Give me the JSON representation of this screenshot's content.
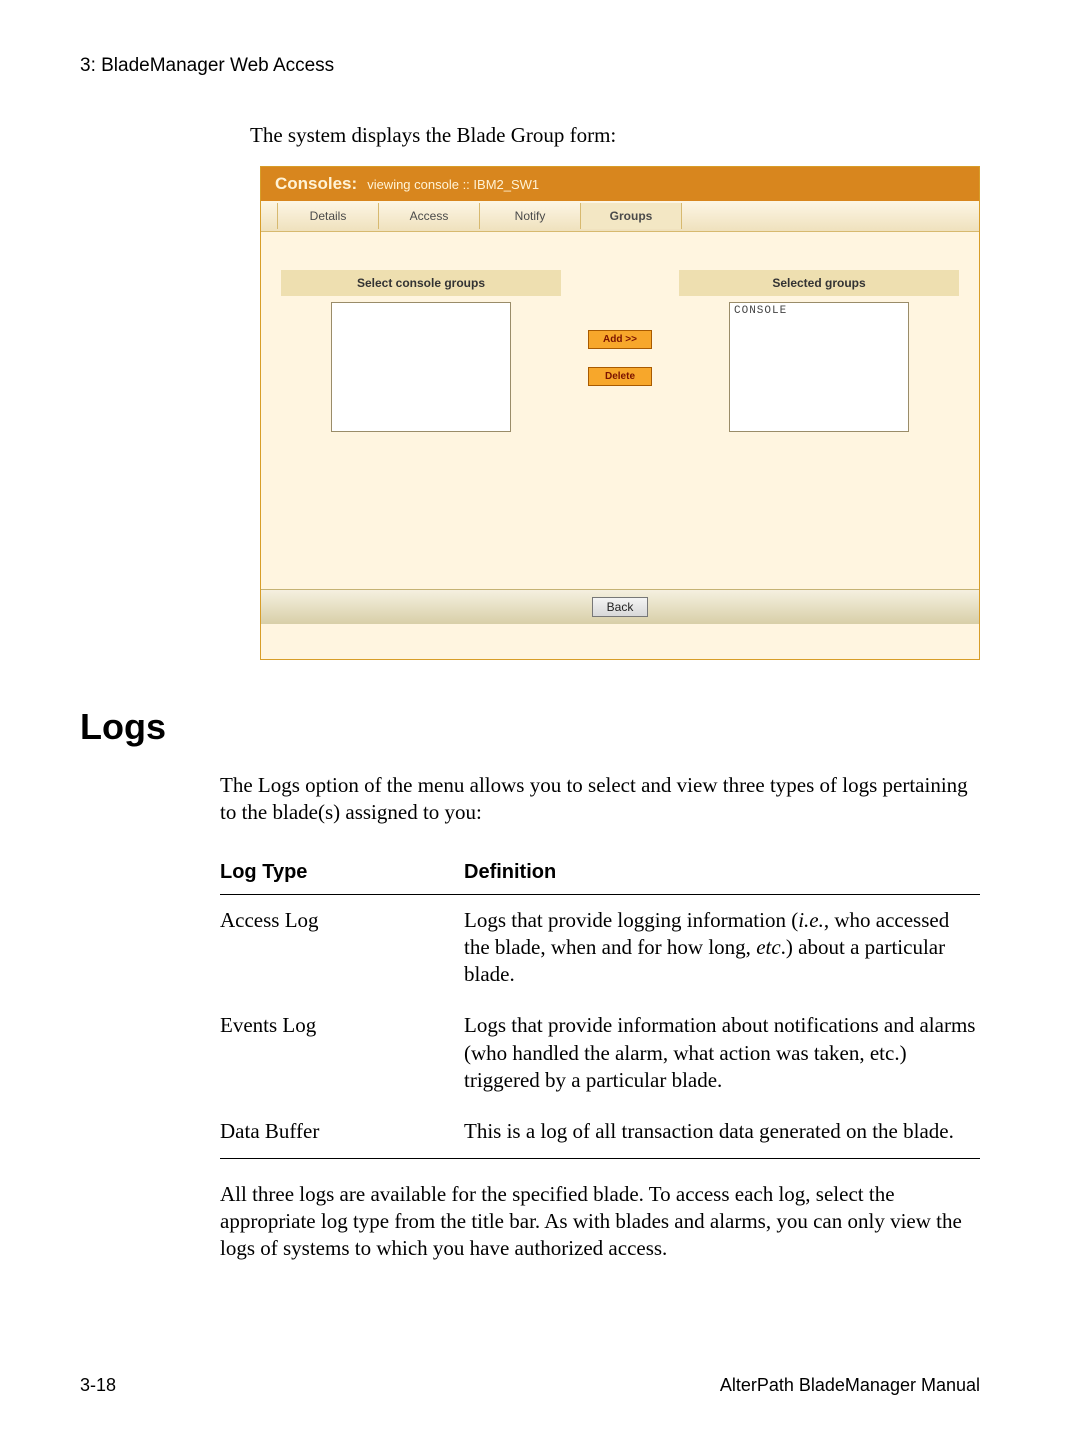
{
  "header": "3: BladeManager Web Access",
  "intro": "The system displays the Blade Group form:",
  "shot": {
    "title_main": "Consoles:",
    "title_sub": "viewing console  ::  IBM2_SW1",
    "tabs": [
      "Details",
      "Access",
      "Notify",
      "Groups"
    ],
    "active_tab": 3,
    "left_header": "Select console groups",
    "right_header": "Selected groups",
    "right_item": "CONSOLE",
    "btn_add": "Add >>",
    "btn_delete": "Delete",
    "btn_back": "Back"
  },
  "section_heading": "Logs",
  "para1": "The Logs option of the menu allows you to select and view three types of logs pertaining to the blade(s) assigned to you:",
  "table": {
    "h1": "Log Type",
    "h2": "Definition",
    "rows": [
      {
        "type": "Access Log",
        "def_pre": "Logs that provide logging information (",
        "def_i1": "i.e.",
        "def_mid": ", who accessed the blade, when and for how long, ",
        "def_i2": "etc",
        "def_post": ".) about a particular blade."
      },
      {
        "type": "Events Log",
        "def": "Logs that provide information about notifications and alarms (who handled the alarm, what action was taken, etc.) triggered by a particular blade."
      },
      {
        "type": "Data Buffer",
        "def": "This is a log of all transaction data generated on the blade."
      }
    ]
  },
  "para2": "All three logs are available for the specified blade. To access each log, select the appropriate log type from the title bar. As with blades and alarms, you can only view the logs of systems to which you have authorized access.",
  "footer_left": "3-18",
  "footer_right": "AlterPath BladeManager Manual"
}
